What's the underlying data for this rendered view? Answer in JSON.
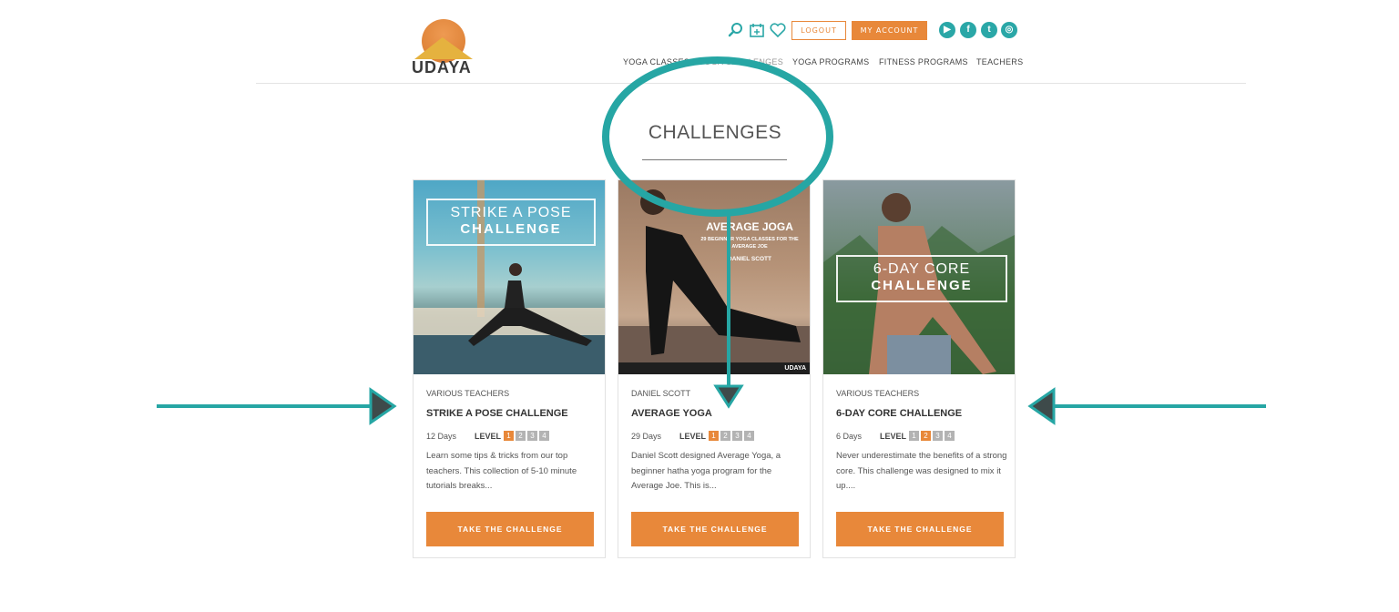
{
  "brand": {
    "name": "UDAYA"
  },
  "header": {
    "icons": [
      "search-icon",
      "calendar-icon",
      "heart-icon"
    ],
    "logout_label": "LOGOUT",
    "account_label": "MY ACCOUNT",
    "social": [
      {
        "name": "youtube-icon",
        "glyph": "▶"
      },
      {
        "name": "facebook-icon",
        "glyph": "f"
      },
      {
        "name": "twitter-icon",
        "glyph": "t"
      },
      {
        "name": "instagram-icon",
        "glyph": "◎"
      }
    ],
    "nav": [
      "YOGA CLASSES",
      "YOGA CHALLENGES",
      "YOGA PROGRAMS",
      "FITNESS PROGRAMS",
      "TEACHERS"
    ]
  },
  "page_title": "CHALLENGES",
  "cards": [
    {
      "teacher": "VARIOUS TEACHERS",
      "name": "STRIKE A POSE CHALLENGE",
      "days": "12 Days",
      "level_label": "LEVEL",
      "levels": [
        "1",
        "2",
        "3",
        "4"
      ],
      "active_level": 1,
      "description": "Learn some tips & tricks from our top teachers. This collection of 5-10 minute tutorials breaks...",
      "button": "TAKE THE CHALLENGE",
      "image_text_1": "STRIKE A POSE",
      "image_text_2": "CHALLENGE"
    },
    {
      "teacher": "DANIEL SCOTT",
      "name": "AVERAGE YOGA",
      "days": "29 Days",
      "level_label": "LEVEL",
      "levels": [
        "1",
        "2",
        "3",
        "4"
      ],
      "active_level": 1,
      "description": "Daniel Scott designed Average Yoga, a beginner hatha yoga program for the Average Joe. This is...",
      "button": "TAKE THE CHALLENGE",
      "image_text_1": "AVERAGE JOGA",
      "image_text_2": "29 BEGINNER YOGA CLASSES FOR THE AVERAGE JOE",
      "image_text_3": "DANIEL SCOTT",
      "image_brand": "UDAYA"
    },
    {
      "teacher": "VARIOUS TEACHERS",
      "name": "6-DAY CORE CHALLENGE",
      "days": "6 Days",
      "level_label": "LEVEL",
      "levels": [
        "1",
        "2",
        "3",
        "4"
      ],
      "active_level": 2,
      "description": "Never underestimate the benefits of a strong core. This challenge was designed to mix it up....",
      "button": "TAKE THE CHALLENGE",
      "image_text_1": "6-DAY CORE",
      "image_text_2": "CHALLENGE"
    }
  ],
  "colors": {
    "accent": "#e8883a",
    "teal": "#2aa7a7"
  }
}
